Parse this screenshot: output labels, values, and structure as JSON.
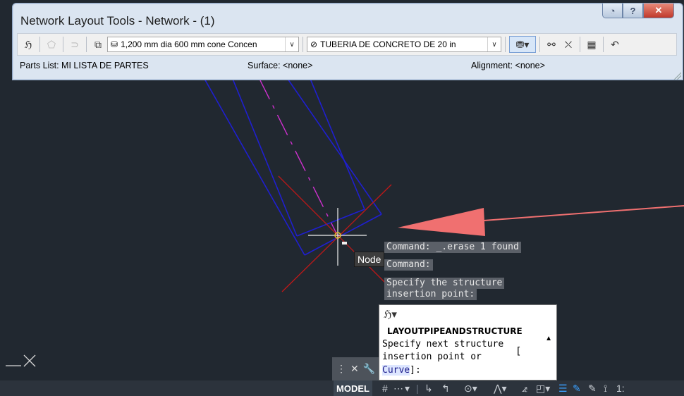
{
  "window": {
    "title": "Network Layout Tools - Network - (1)",
    "controls": {
      "min": "◔",
      "help": "?",
      "close": "✕"
    }
  },
  "toolbar": {
    "structure_combo": "1,200 mm dia 600 mm cone Concen",
    "pipe_combo": "TUBERIA DE CONCRETO DE 20 in"
  },
  "status": {
    "parts_list": "Parts List: MI LISTA DE PARTES",
    "surface": "Surface: <none>",
    "alignment": "Alignment: <none>"
  },
  "command_history": [
    "Command: _.erase 1 found",
    "Command:",
    "Specify the structure",
    "insertion point:"
  ],
  "osnap_tooltip": "Node",
  "command_prompt": {
    "command_name": "LAYOUTPIPEANDSTRUCTURE",
    "line1": "Specify next structure",
    "bracket_open": "[",
    "line2": "insertion point or",
    "option": "Curve",
    "line3_suffix": "]:"
  },
  "statusbar": {
    "model": "MODEL"
  },
  "colors": {
    "background": "#212830",
    "pipe": "#1f1fd0",
    "centerline": "#d030d0",
    "crosshair": "#c01818",
    "arrow": "#f07070"
  }
}
